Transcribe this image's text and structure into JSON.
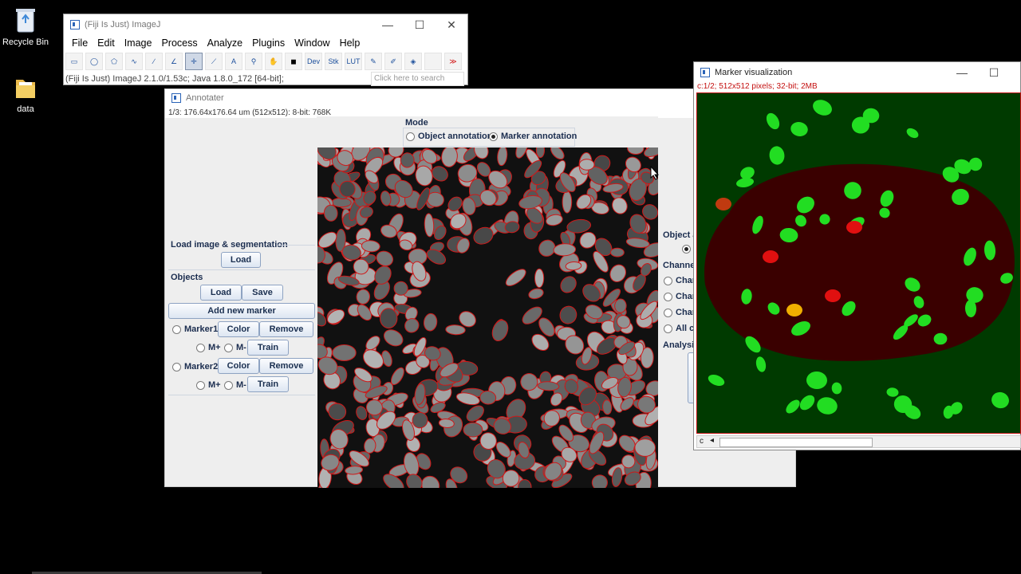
{
  "desktop": {
    "icons": [
      {
        "name": "recycle-bin",
        "label": "Recycle Bin"
      },
      {
        "name": "data-folder",
        "label": "data"
      }
    ]
  },
  "imagej": {
    "title": "(Fiji Is Just) ImageJ",
    "menu": [
      "File",
      "Edit",
      "Image",
      "Process",
      "Analyze",
      "Plugins",
      "Window",
      "Help"
    ],
    "tools": [
      {
        "icon": "rectangle-tool-icon",
        "glyph": "▭"
      },
      {
        "icon": "oval-tool-icon",
        "glyph": "◯"
      },
      {
        "icon": "polygon-tool-icon",
        "glyph": "⬠"
      },
      {
        "icon": "freehand-tool-icon",
        "glyph": "∿"
      },
      {
        "icon": "line-tool-icon",
        "glyph": "∕"
      },
      {
        "icon": "angle-tool-icon",
        "glyph": "∠"
      },
      {
        "icon": "point-tool-icon",
        "glyph": "✛"
      },
      {
        "icon": "wand-tool-icon",
        "glyph": "⟋"
      },
      {
        "icon": "text-tool-icon",
        "glyph": "A"
      },
      {
        "icon": "magnifier-tool-icon",
        "glyph": "⚲"
      },
      {
        "icon": "hand-tool-icon",
        "glyph": "✋"
      },
      {
        "icon": "color-picker-tool-icon",
        "glyph": "◼"
      },
      {
        "icon": "dev-tool-icon",
        "glyph": "Dev"
      },
      {
        "icon": "stk-tool-icon",
        "glyph": "Stk"
      },
      {
        "icon": "lut-tool-icon",
        "glyph": "LUT"
      },
      {
        "icon": "pencil-tool-icon",
        "glyph": "✎"
      },
      {
        "icon": "brush-tool-icon",
        "glyph": "✐"
      },
      {
        "icon": "flood-fill-tool-icon",
        "glyph": "◈"
      },
      {
        "icon": "blank-tool-icon",
        "glyph": ""
      },
      {
        "icon": "more-tools-icon",
        "glyph": "≫"
      }
    ],
    "selected_tool_index": 6,
    "status": "(Fiji Is Just) ImageJ 2.1.0/1.53c; Java 1.8.0_172 [64-bit];",
    "search_placeholder": "Click here to search"
  },
  "annotater": {
    "title": "Annotater",
    "info": "1/3: 176.64x176.64 um (512x512): 8-bit: 768K",
    "mode": {
      "label": "Mode",
      "options": [
        "Object annotation",
        "Marker annotation"
      ],
      "selected": 1
    },
    "load_section": {
      "label": "Load image & segmentation",
      "load_button": "Load"
    },
    "objects": {
      "label": "Objects",
      "load_button": "Load",
      "save_button": "Save",
      "add_marker_button": "Add new marker",
      "markers": [
        {
          "name": "Marker1",
          "color_button": "Color",
          "remove_button": "Remove",
          "plus": "M+",
          "minus": "M-",
          "train_button": "Train"
        },
        {
          "name": "Marker2",
          "color_button": "Color",
          "remove_button": "Remove",
          "plus": "M+",
          "minus": "M-",
          "train_button": "Train"
        }
      ]
    },
    "right_panel": {
      "object_label": "Object a",
      "channel_label": "Channel",
      "channels": [
        "Chan",
        "Chan",
        "Chan",
        "All ch"
      ],
      "analysis_label": "Analysis"
    }
  },
  "marker_vis": {
    "title": "Marker visualization",
    "info": "c:1/2; 512x512 pixels; 32-bit; 2MB",
    "scroll_label": "c"
  },
  "colors": {
    "vis_background": "#003a00",
    "vis_region": "#3a0000",
    "marker_green": "#22dd22",
    "marker_red": "#e01010",
    "marker_yellow": "#f0b000",
    "marker_orange": "#c03a10",
    "outline_red": "#d01818"
  }
}
